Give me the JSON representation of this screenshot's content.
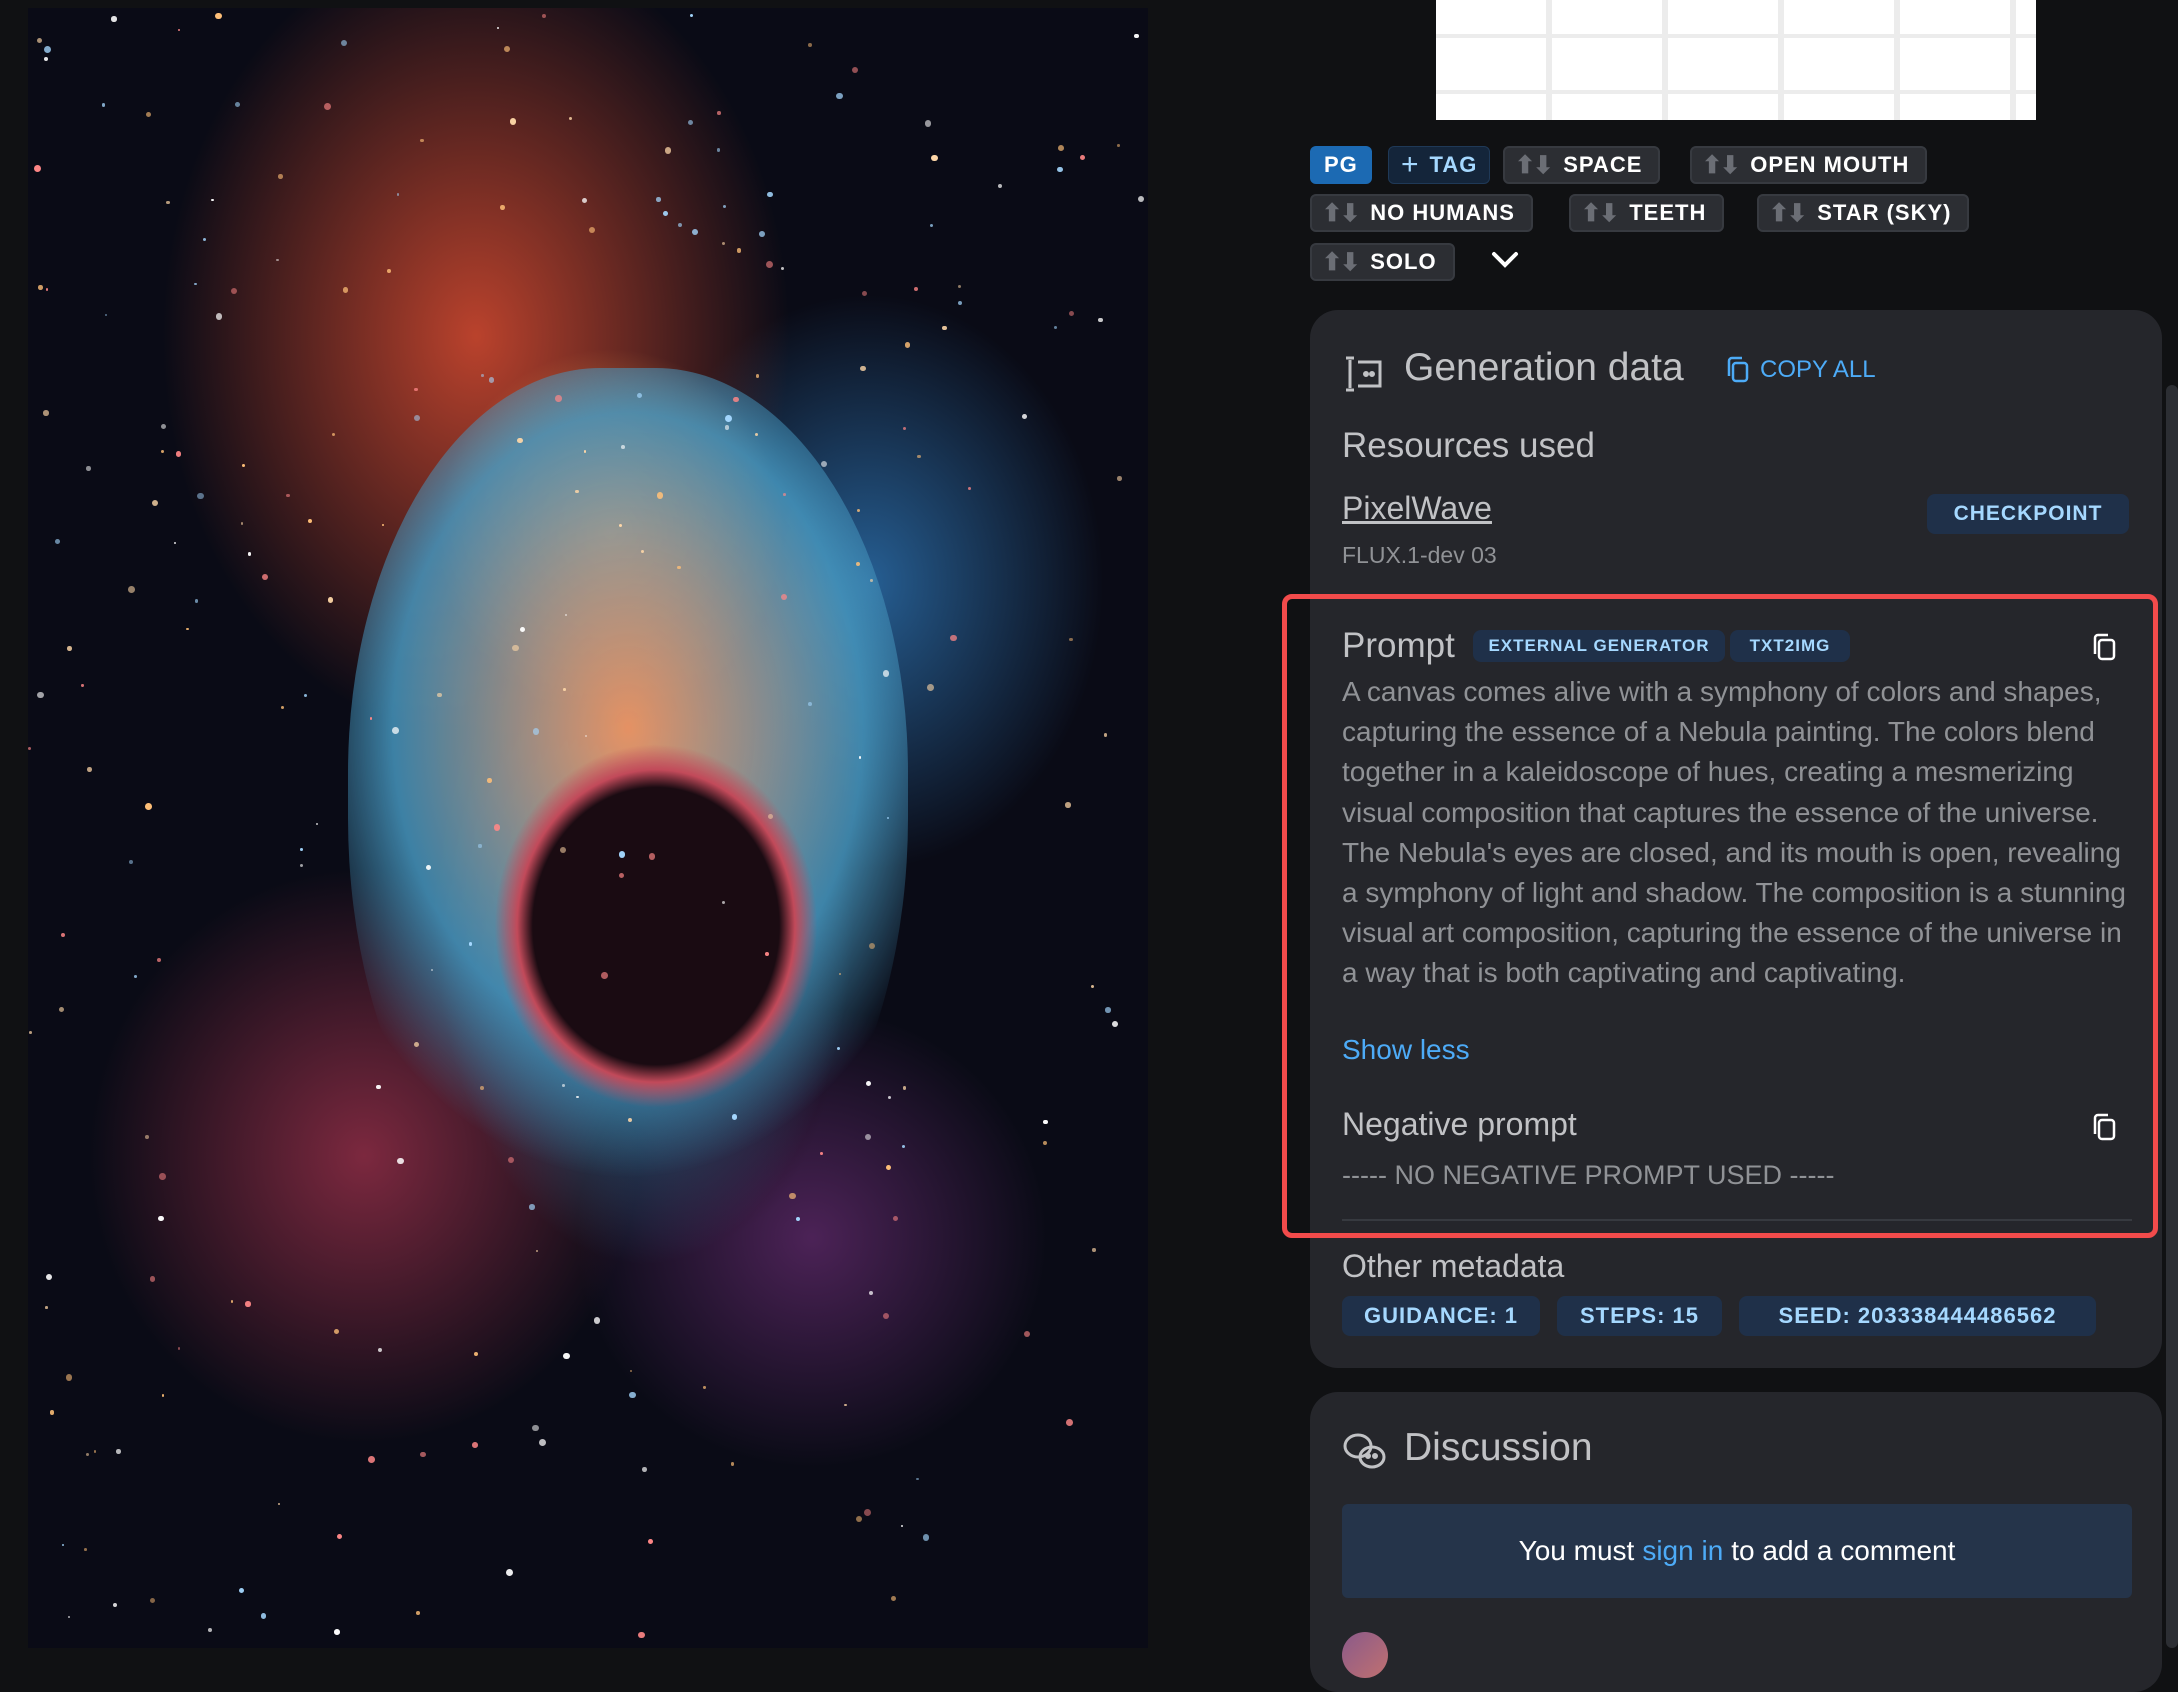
{
  "tags": {
    "rating": "PG",
    "add_tag": "TAG",
    "items": [
      {
        "label": "SPACE"
      },
      {
        "label": "OPEN MOUTH"
      },
      {
        "label": "NO HUMANS"
      },
      {
        "label": "TEETH"
      },
      {
        "label": "STAR (SKY)"
      },
      {
        "label": "SOLO"
      }
    ],
    "expand_icon": "chevron-down-icon",
    "vote_icons": "⬆⬇"
  },
  "generation": {
    "title": "Generation data",
    "copy_all": "COPY ALL",
    "resources_title": "Resources used",
    "resource": {
      "name": "PixelWave",
      "version": "FLUX.1-dev 03",
      "type": "CHECKPOINT"
    },
    "prompt": {
      "label": "Prompt",
      "badges": [
        "EXTERNAL GENERATOR",
        "TXT2IMG"
      ],
      "text": "A canvas comes alive with a symphony of colors and shapes, capturing the essence of a Nebula painting. The colors blend together in a kaleidoscope of hues, creating a mesmerizing visual composition that captures the essence of the universe. The Nebula's eyes are closed, and its mouth is open, revealing a symphony of light and shadow. The composition is a stunning visual art composition, capturing the essence of the universe in a way that is both captivating and captivating.",
      "toggle": "Show less"
    },
    "negative": {
      "label": "Negative prompt",
      "text": "----- NO NEGATIVE PROMPT USED -----"
    },
    "other": {
      "title": "Other metadata",
      "items": [
        "GUIDANCE: 1",
        "STEPS: 15",
        "SEED: 203338444486562"
      ]
    }
  },
  "discussion": {
    "title": "Discussion",
    "before": "You must",
    "link": "sign in",
    "after": "to add a comment"
  },
  "colors": {
    "accent": "#4dabf7",
    "highlight": "#f24b4b",
    "card": "#25262b",
    "background": "#101113"
  }
}
